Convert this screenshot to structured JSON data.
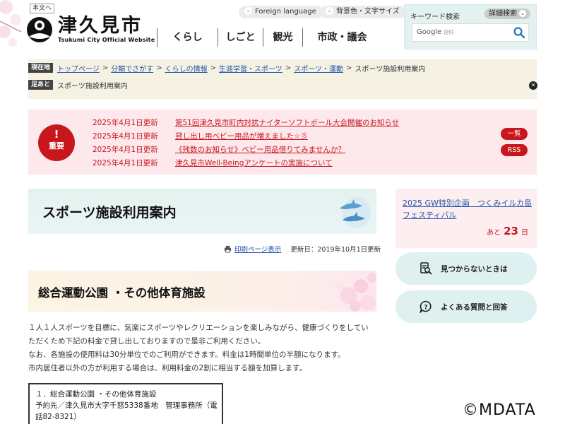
{
  "header": {
    "skip_link": "本文へ",
    "logo_jp": "津久見市",
    "logo_en": "Tsukumi City Official Website",
    "foreign_language": "Foreign language",
    "background_text": "背景色・文字サイズ",
    "nav": [
      "くらし",
      "しごと",
      "観光",
      "市政・議会"
    ]
  },
  "search": {
    "title": "キーワード検索",
    "advanced": "詳細検索",
    "google_label": "Google",
    "google_small": "提供"
  },
  "breadcrumb": {
    "current_label": "現在地",
    "items": [
      "トップページ",
      "分類でさがす",
      "くらしの情報",
      "生涯学習・スポーツ",
      "スポーツ・運動"
    ],
    "current": "スポーツ施設利用案内",
    "history_label": "足あと",
    "history_item": "スポーツ施設利用案内"
  },
  "alert": {
    "mark": "!",
    "word": "重要",
    "news": [
      {
        "date": "2025年4月1日更新",
        "title": "第51回津久見市町内対抗ナイターソフトボール大会開催のお知らせ"
      },
      {
        "date": "2025年4月1日更新",
        "title": "貸し出し用ベビー用品が増えました☆彡"
      },
      {
        "date": "2025年4月1日更新",
        "title": "《残数のお知らせ》ベビー用品借りてみませんか？"
      },
      {
        "date": "2025年4月1日更新",
        "title": "津久見市Well-Beingアンケートの実施について"
      }
    ],
    "list_button": "一覧",
    "rss_button": "RSS"
  },
  "main": {
    "page_title": "スポーツ施設利用案内",
    "print_link": "印刷ページ表示",
    "updated": "更新日：2019年10月1日更新",
    "section_title": "総合運動公園 ・その他体育施設",
    "paragraphs": [
      "１人１人スポーツを目標に、気楽にスポーツやレクリエーションを楽しみながら、健康づくりをしてい",
      "ただくため下記の料金で貸し出しておりますので是非ご利用ください。",
      "なお、各施設の使用料は30分単位でのご利用ができます。料金は1時間単位の半額になります。",
      "市内居住者以外の方が利用する場合は、利用料金の2割に相当する額を加算します。"
    ],
    "info_box": [
      "１．総合運動公園 ・その他体育施設",
      "予約先／津久見市大字千怒5338番地　管理事務所（電",
      "話82-8321）"
    ]
  },
  "side": {
    "event_title": "2025 GW特別企画　つくみイルカ島フェスティバル",
    "countdown_prefix": "あと",
    "countdown_days": "23",
    "countdown_suffix": "日",
    "not_found": "見つからないときは",
    "faq": "よくある質問と回答"
  },
  "watermark": "©MDATA",
  "colors": {
    "accent_red": "#c8161d",
    "link_blue": "#2255aa",
    "mint": "#dff0f0",
    "cream": "#f5f2e4",
    "pink": "#fde9ec"
  }
}
